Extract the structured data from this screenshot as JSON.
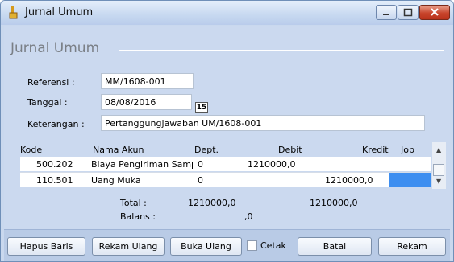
{
  "window": {
    "title": "Jurnal Umum"
  },
  "group": {
    "title": "Jurnal Umum"
  },
  "form": {
    "referensi_label": "Referensi :",
    "referensi_value": "MM/1608-001",
    "tanggal_label": "Tanggal :",
    "tanggal_value": "08/08/2016",
    "calendar_icon_text": "15",
    "keterangan_label": "Keterangan :",
    "keterangan_value": "Pertanggungjawaban UM/1608-001"
  },
  "grid": {
    "columns": [
      "Kode",
      "Nama Akun",
      "Dept.",
      "Debit",
      "Kredit",
      "Job"
    ],
    "rows": [
      {
        "kode": "500.202",
        "nama": "Biaya Pengiriman Samp",
        "dept": "0",
        "debit": "1210000,0",
        "kredit": "",
        "job": ""
      },
      {
        "kode": "110.501",
        "nama": "Uang Muka",
        "dept": "0",
        "debit": "",
        "kredit": "1210000,0",
        "job": ""
      }
    ]
  },
  "summary": {
    "total_label": "Total :",
    "total_debit": "1210000,0",
    "total_kredit": "1210000,0",
    "balans_label": "Balans :",
    "balans_value": ",0"
  },
  "buttons": {
    "hapus": "Hapus Baris",
    "rekam_ulang": "Rekam Ulang",
    "buka_ulang": "Buka Ulang",
    "cetak": "Cetak",
    "batal": "Batal",
    "rekam": "Rekam"
  },
  "colors": {
    "selected_cell": "#3d8ef0",
    "close_button": "#c8452c",
    "group_title": "#7a7f86"
  }
}
